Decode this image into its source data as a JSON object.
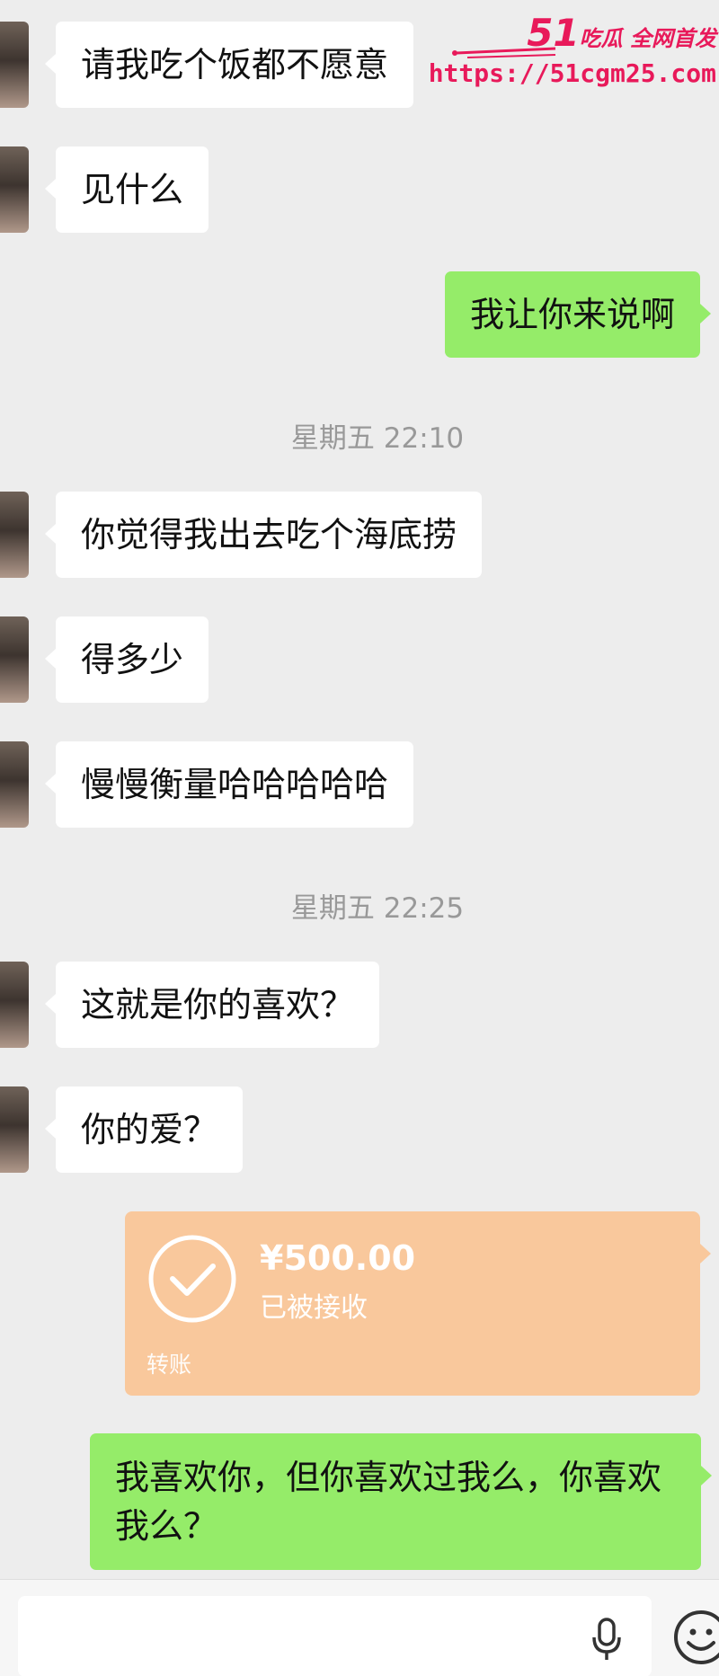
{
  "watermark": {
    "brand_number": "51",
    "brand_text": "吃瓜 全网首发",
    "url": "https://51cgm25.com"
  },
  "messages": [
    {
      "side": "left",
      "text": "请我吃个饭都不愿意"
    },
    {
      "side": "left",
      "text": "见什么"
    },
    {
      "side": "right",
      "text": "我让你来说啊"
    },
    {
      "type": "timestamp",
      "text": "星期五 22:10"
    },
    {
      "side": "left",
      "text": "你觉得我出去吃个海底捞"
    },
    {
      "side": "left",
      "text": "得多少"
    },
    {
      "side": "left",
      "text": "慢慢衡量哈哈哈哈哈"
    },
    {
      "type": "timestamp",
      "text": "星期五 22:25"
    },
    {
      "side": "left",
      "text": "这就是你的喜欢？"
    },
    {
      "side": "left",
      "text": "你的爱？"
    },
    {
      "type": "transfer",
      "amount": "¥500.00",
      "status": "已被接收",
      "label": "转账"
    },
    {
      "side": "right",
      "text": "我喜欢你，但你喜欢过我么，你喜欢我么？"
    }
  ],
  "input_bar": {
    "value": "",
    "icons": [
      "microphone-icon",
      "emoji-icon"
    ]
  },
  "colors": {
    "background": "#ededed",
    "received_bubble": "#ffffff",
    "sent_bubble": "#95ec69",
    "transfer_card": "#f9c89c",
    "timestamp_text": "#999999",
    "watermark": "#e8195a"
  }
}
